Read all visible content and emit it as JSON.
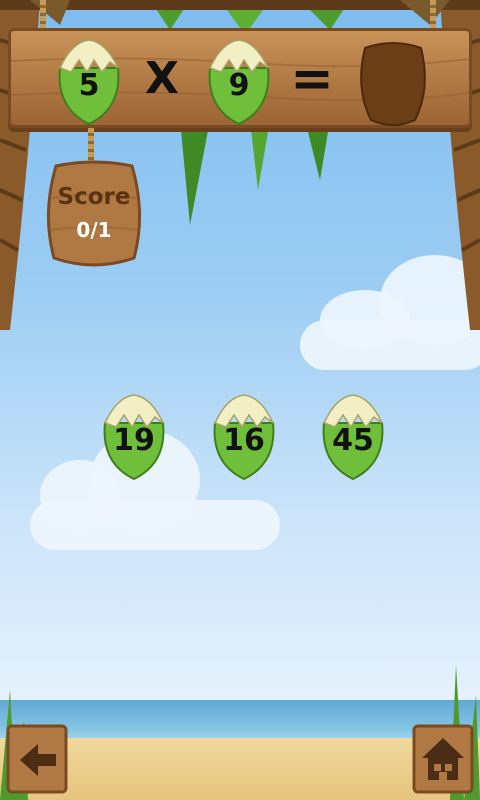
{
  "equation": {
    "operand_a": "5",
    "operator": "X",
    "operand_b": "9",
    "equals": "=",
    "answer": ""
  },
  "score": {
    "label": "Score",
    "value": "0/1"
  },
  "choices": [
    "19",
    "16",
    "45"
  ],
  "icons": {
    "back": "back-arrow-icon",
    "home": "home-icon"
  },
  "colors": {
    "coconut_green": "#6fbf3a",
    "wood": "#b07843",
    "sky": "#7dbcef"
  }
}
